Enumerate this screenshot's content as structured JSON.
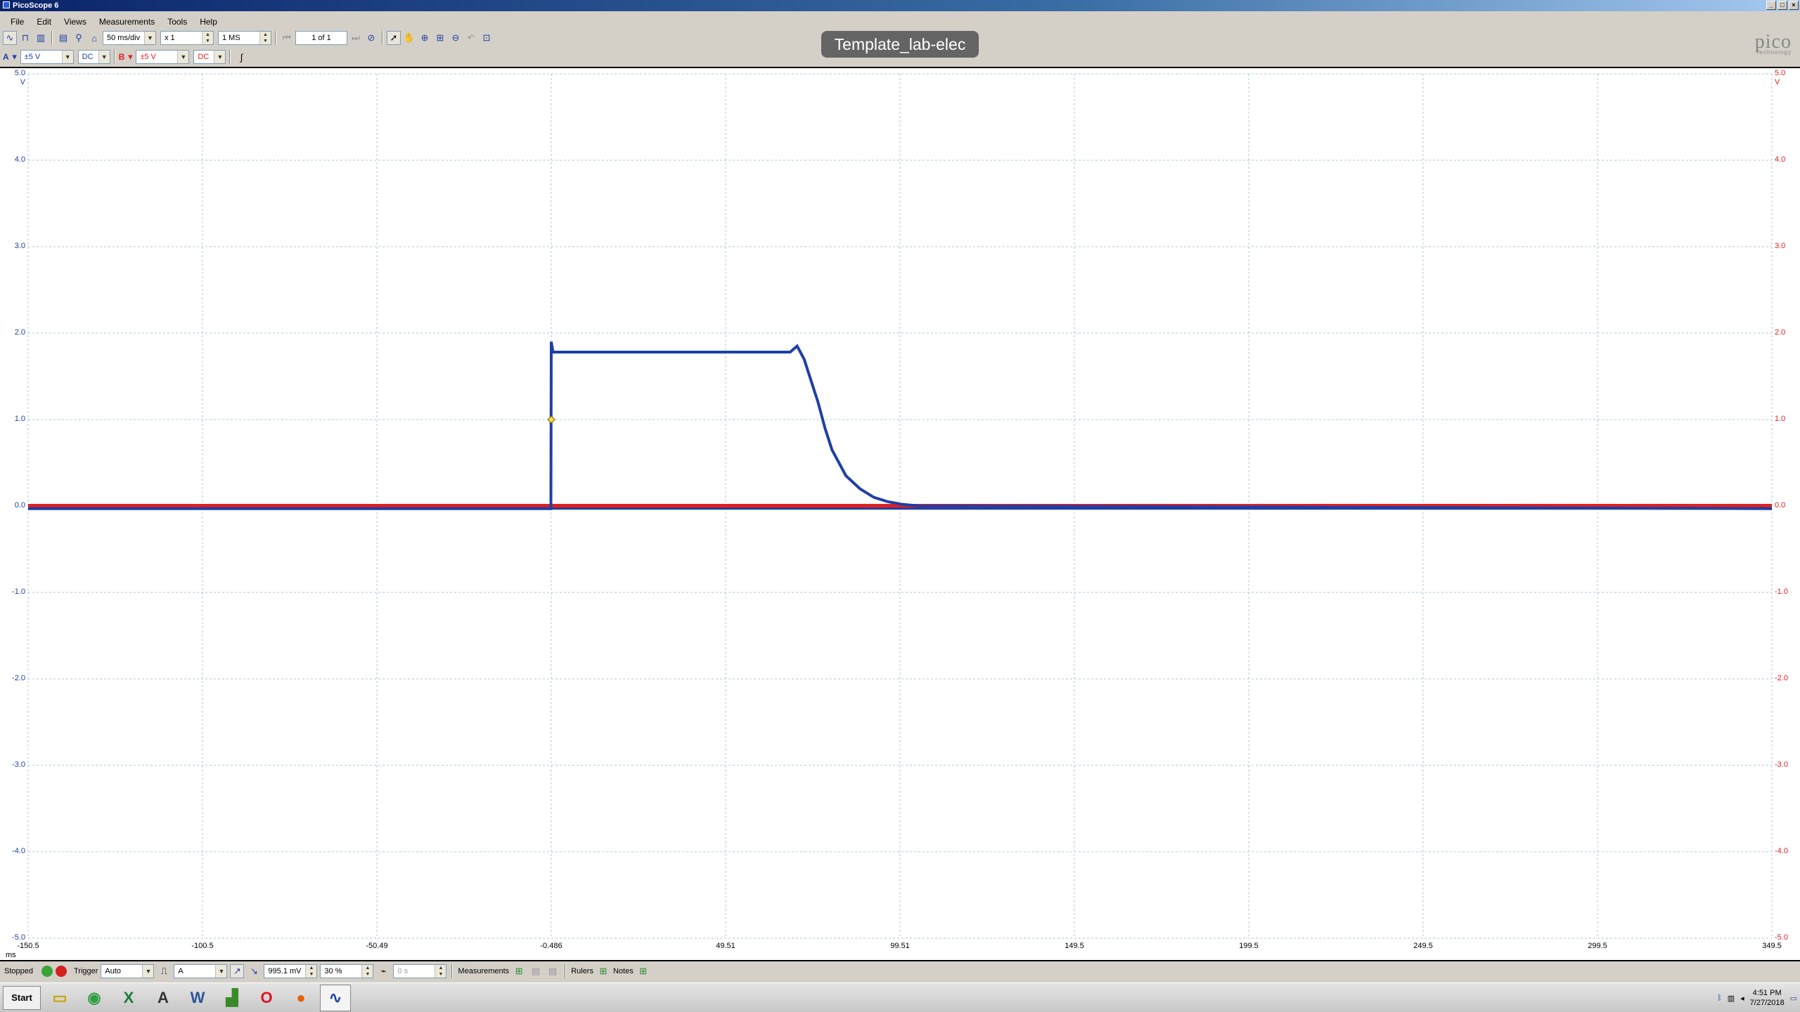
{
  "window": {
    "title": "PicoScope 6",
    "buttons": [
      "_",
      "□",
      "×"
    ]
  },
  "menu": [
    "File",
    "Edit",
    "Views",
    "Measurements",
    "Tools",
    "Help"
  ],
  "toolbar": {
    "timebase": "50 ms/div",
    "zoom": "x 1",
    "samples": "1 MS",
    "buffer": "1 of 1",
    "tooltip": "Template_lab-elec"
  },
  "channels": {
    "a": {
      "label": "A",
      "range": "±5 V",
      "coupling": "DC",
      "color": "#1f3fa6"
    },
    "b": {
      "label": "B",
      "range": "±5 V",
      "coupling": "DC",
      "color": "#e02020"
    }
  },
  "logo": {
    "brand": "pico",
    "sub": "Technology"
  },
  "axes": {
    "y_ticks_left": [
      "5.0",
      "4.0",
      "3.0",
      "2.0",
      "1.0",
      "0.0",
      "-1.0",
      "-2.0",
      "-3.0",
      "-4.0",
      "-5.0"
    ],
    "y_ticks_right": [
      "5.0",
      "4.0",
      "3.0",
      "2.0",
      "1.0",
      "0.0",
      "-1.0",
      "-2.0",
      "-3.0",
      "-4.0",
      "-5.0"
    ],
    "y_unit_left": "V",
    "y_unit_right": "V",
    "x_ticks": [
      "-150.5",
      "-100.5",
      "-50.49",
      "-0.486",
      "49.51",
      "99.51",
      "149.5",
      "199.5",
      "249.5",
      "299.5",
      "349.5"
    ],
    "x_unit": "ms"
  },
  "chart_data": {
    "type": "line",
    "xlabel": "ms",
    "ylabel": "V",
    "xlim": [
      -150.5,
      349.5
    ],
    "ylim": [
      -5.0,
      5.0
    ],
    "grid": true,
    "series": [
      {
        "name": "A",
        "color": "#1f3fa6",
        "x": [
          -150.5,
          -0.6,
          -0.5,
          0.0,
          68.0,
          70.0,
          72.0,
          74.0,
          76.0,
          78.0,
          80.0,
          84.0,
          88.0,
          92.0,
          96.0,
          100.0,
          105.0,
          349.5
        ],
        "y": [
          -0.03,
          -0.03,
          1.9,
          1.78,
          1.78,
          1.85,
          1.7,
          1.45,
          1.2,
          0.9,
          0.65,
          0.35,
          0.2,
          0.1,
          0.05,
          0.02,
          0.0,
          -0.03
        ]
      },
      {
        "name": "B",
        "color": "#e02020",
        "x": [
          -150.5,
          349.5
        ],
        "y": [
          0.0,
          0.0
        ]
      }
    ],
    "trigger": {
      "x": -0.486,
      "y": 1.0
    }
  },
  "status": {
    "state": "Stopped",
    "trigger_label": "Trigger",
    "trigger_mode": "Auto",
    "trigger_source": "A",
    "threshold": "995.1 mV",
    "pretrigger": "30 %",
    "delay": "0 s",
    "measurements_label": "Measurements",
    "rulers_label": "Rulers",
    "notes_label": "Notes"
  },
  "taskbar": {
    "start": "Start",
    "time": "4:51 PM",
    "date": "7/27/2018"
  }
}
